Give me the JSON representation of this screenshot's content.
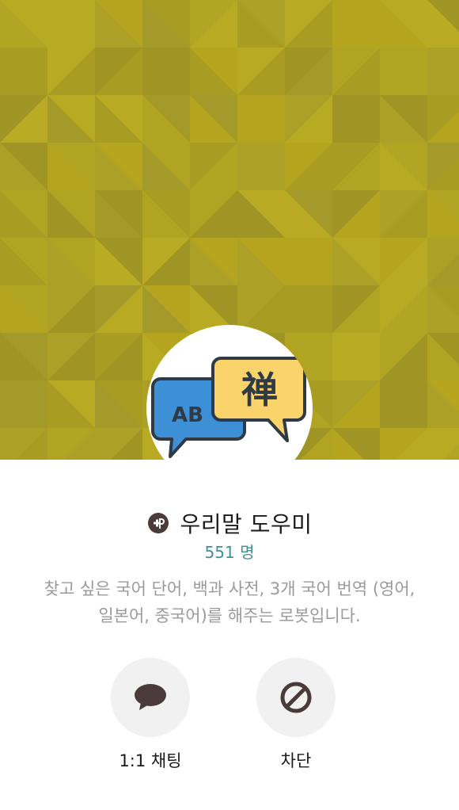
{
  "profile": {
    "name": "우리말 도우미",
    "members": "551 명",
    "description": "찾고 싶은 국어 단어, 백과 사전, 3개 국어 번역 (영어, 일본어, 중국어)를 해주는 로봇입니다.",
    "plus_badge_icon": "kakao-plus-icon",
    "avatar": {
      "left_text": "AB",
      "right_text": "禅"
    }
  },
  "actions": {
    "chat_label": "1:1 채팅",
    "chat_icon": "speech-bubble-icon",
    "block_label": "차단",
    "block_icon": "block-icon"
  },
  "colors": {
    "cover": "#b2a423",
    "title": "#1a1a1a",
    "members": "#3f9196",
    "description": "#9a9a9a",
    "action_bg": "#f1f1f1",
    "icon": "#4a3a3a"
  }
}
